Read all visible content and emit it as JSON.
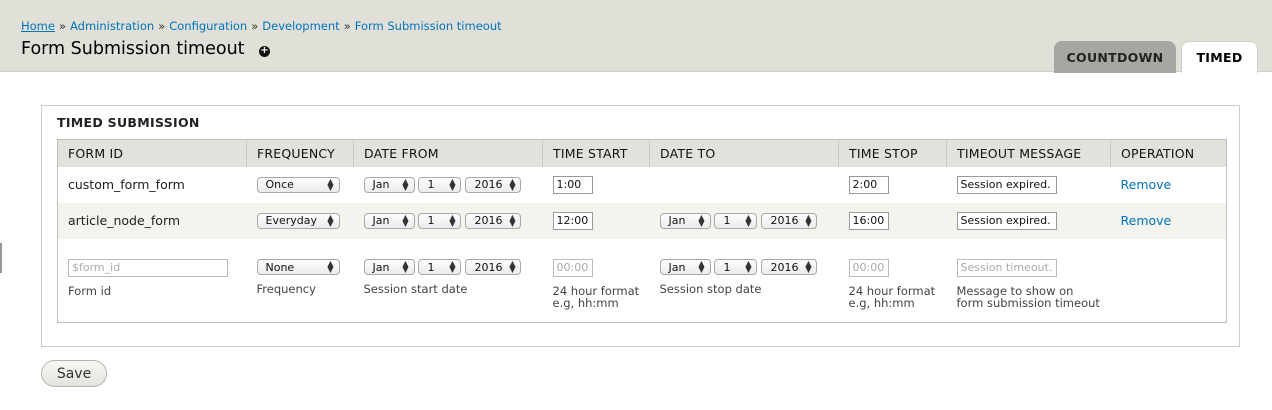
{
  "breadcrumb": {
    "items": [
      "Home",
      "Administration",
      "Configuration",
      "Development",
      "Form Submission timeout"
    ],
    "separator": "»"
  },
  "page_title": "Form Submission timeout",
  "shortcut_symbol": "+",
  "tabs": [
    {
      "label": "COUNTDOWN",
      "active": false
    },
    {
      "label": "TIMED",
      "active": true
    }
  ],
  "fieldset": {
    "legend": "TIMED SUBMISSION",
    "columns": [
      "FORM ID",
      "FREQUENCY",
      "DATE FROM",
      "TIME START",
      "DATE TO",
      "TIME STOP",
      "TIMEOUT MESSAGE",
      "OPERATION"
    ],
    "rows": [
      {
        "form_id": "custom_form_form",
        "frequency": "Once",
        "date_from": {
          "month": "Jan",
          "day": "1",
          "year": "2016"
        },
        "time_start": "1:00",
        "date_to": null,
        "time_stop": "2:00",
        "message": "Session expired.",
        "operation": "Remove"
      },
      {
        "form_id": "article_node_form",
        "frequency": "Everyday",
        "date_from": {
          "month": "Jan",
          "day": "1",
          "year": "2016"
        },
        "time_start": "12:00",
        "date_to": {
          "month": "Jan",
          "day": "1",
          "year": "2016"
        },
        "time_stop": "16:00",
        "message": "Session expired.",
        "operation": "Remove"
      }
    ],
    "new_row": {
      "form_id_placeholder": "$form_id",
      "form_id_desc": "Form id",
      "frequency": "None",
      "frequency_desc": "Frequency",
      "date_from": {
        "month": "Jan",
        "day": "1",
        "year": "2016"
      },
      "date_from_desc": "Session start date",
      "time_start_placeholder": "00:00",
      "time_start_desc_1": "24 hour format",
      "time_start_desc_2": "e.g, hh:mm",
      "date_to": {
        "month": "Jan",
        "day": "1",
        "year": "2016"
      },
      "date_to_desc": "Session stop date",
      "time_stop_placeholder": "00:00",
      "time_stop_desc_1": "24 hour format",
      "time_stop_desc_2": "e.g, hh:mm",
      "message_placeholder": "Session timeout.",
      "message_desc_1": "Message to show on",
      "message_desc_2": "form submission timeout"
    }
  },
  "save_label": "Save",
  "select_arrow_icon": "up-down-arrows-icon"
}
